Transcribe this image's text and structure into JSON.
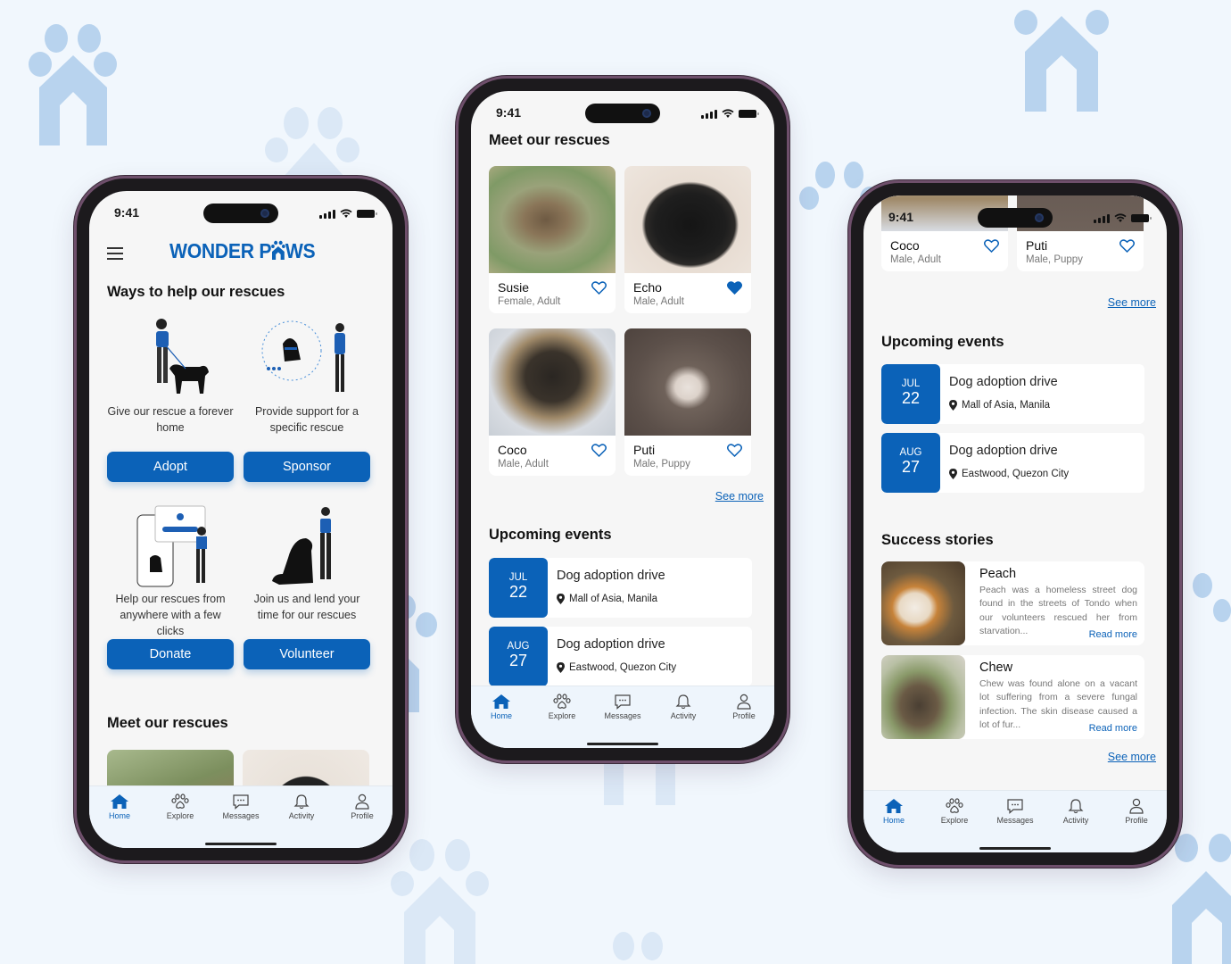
{
  "brand": {
    "name_part1": "WONDER P",
    "name_part2": "WS",
    "accent": "#0b62b8"
  },
  "status_bar": {
    "time": "9:41"
  },
  "phone1": {
    "section_help_title": "Ways to help our rescues",
    "help_items": [
      {
        "text": "Give our rescue a forever home",
        "button": "Adopt"
      },
      {
        "text": "Provide support for a specific rescue",
        "button": "Sponsor"
      },
      {
        "text": "Help our rescues from anywhere with a few clicks",
        "button": "Donate"
      },
      {
        "text": "Join us and lend your time for our rescues",
        "button": "Volunteer"
      }
    ],
    "section_rescues_title": "Meet our rescues"
  },
  "phone2": {
    "section_rescues_title": "Meet our rescues",
    "rescues": [
      {
        "name": "Susie",
        "meta": "Female, Adult",
        "favorited": false
      },
      {
        "name": "Echo",
        "meta": "Male, Adult",
        "favorited": true
      },
      {
        "name": "Coco",
        "meta": "Male, Adult",
        "favorited": false
      },
      {
        "name": "Puti",
        "meta": "Male, Puppy",
        "favorited": false
      }
    ],
    "see_more": "See more",
    "section_events_title": "Upcoming events"
  },
  "phone3": {
    "rescues": [
      {
        "name": "Coco",
        "meta": "Male, Adult",
        "favorited": false
      },
      {
        "name": "Puti",
        "meta": "Male, Puppy",
        "favorited": false
      }
    ],
    "see_more_rescues": "See more",
    "section_events_title": "Upcoming events",
    "section_stories_title": "Success stories",
    "stories": [
      {
        "name": "Peach",
        "text": "Peach was a homeless street dog found in the streets of Tondo when our volunteers rescued her from starvation...",
        "read_more": "Read more"
      },
      {
        "name": "Chew",
        "text": "Chew was found alone on a vacant lot suffering from a severe fungal infection. The skin disease caused a lot of fur...",
        "read_more": "Read more"
      }
    ],
    "see_more_stories": "See more"
  },
  "events": [
    {
      "month": "JUL",
      "day": "22",
      "title": "Dog adoption drive",
      "location": "Mall of Asia, Manila"
    },
    {
      "month": "AUG",
      "day": "27",
      "title": "Dog adoption drive",
      "location": "Eastwood, Quezon City"
    }
  ],
  "nav": [
    {
      "label": "Home",
      "icon": "home-icon",
      "active": true
    },
    {
      "label": "Explore",
      "icon": "paw-icon",
      "active": false
    },
    {
      "label": "Messages",
      "icon": "message-icon",
      "active": false
    },
    {
      "label": "Activity",
      "icon": "bell-icon",
      "active": false
    },
    {
      "label": "Profile",
      "icon": "user-icon",
      "active": false
    }
  ]
}
